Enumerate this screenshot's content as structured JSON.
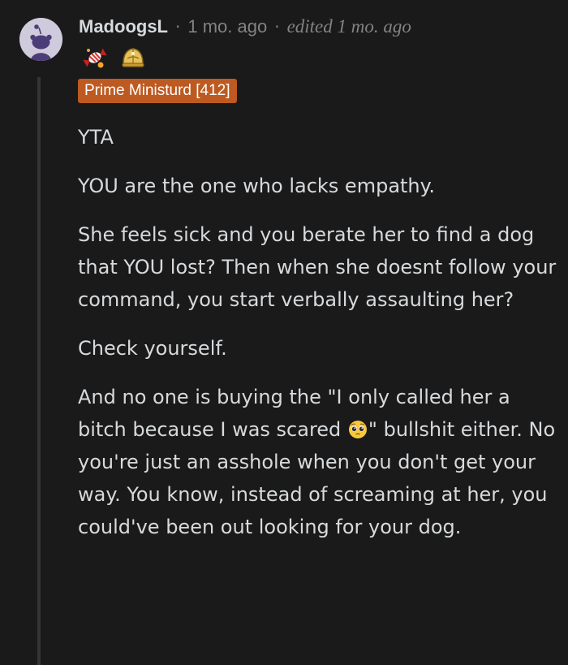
{
  "comment": {
    "author": "MadoogsL",
    "separator": "·",
    "time_ago": "1 mo. ago",
    "edited": "edited 1 mo. ago",
    "awards": [
      "candy-award-icon",
      "gold-helmet-award-icon"
    ],
    "flair": "Prime Ministurd [412]",
    "paragraphs": [
      "YTA",
      "YOU are the one who lacks empathy.",
      "She feels sick and you berate her to find a dog that YOU lost? Then when she doesnt follow your command, you start verbally assaulting her?",
      "Check yourself."
    ],
    "last_paragraph_before_emoji": "And no one is buying the \"I only called her a bitch because I was scared",
    "emoji_name": "pleading-face-emoji",
    "last_paragraph_after_emoji": "\" bullshit either. No you're just an asshole when you don't get your way. You know, instead of screaming at her, you could've been out looking for your dog."
  },
  "colors": {
    "background": "#1a1a1b",
    "text": "#d7dadc",
    "meta_text": "#818384",
    "flair_background": "#bd5a21",
    "thread_line": "#343536"
  }
}
